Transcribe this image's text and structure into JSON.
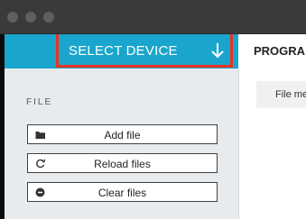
{
  "window": {
    "controls": [
      "close",
      "minimize",
      "maximize"
    ]
  },
  "device_selector": {
    "label": "SELECT DEVICE",
    "icon": "arrow-down-icon",
    "highlighted": true
  },
  "main_tabs": {
    "program_label": "PROGRA"
  },
  "sidebar": {
    "section_title": "FILE",
    "buttons": [
      {
        "label": "Add file",
        "icon": "folder-icon"
      },
      {
        "label": "Reload files",
        "icon": "reload-icon"
      },
      {
        "label": "Clear files",
        "icon": "minus-circle-icon"
      }
    ]
  },
  "file_panel": {
    "header_label": "File mer"
  },
  "colors": {
    "accent": "#1aa6cc",
    "highlight_border": "#ea3323",
    "panel_bg": "#e8ebee"
  }
}
